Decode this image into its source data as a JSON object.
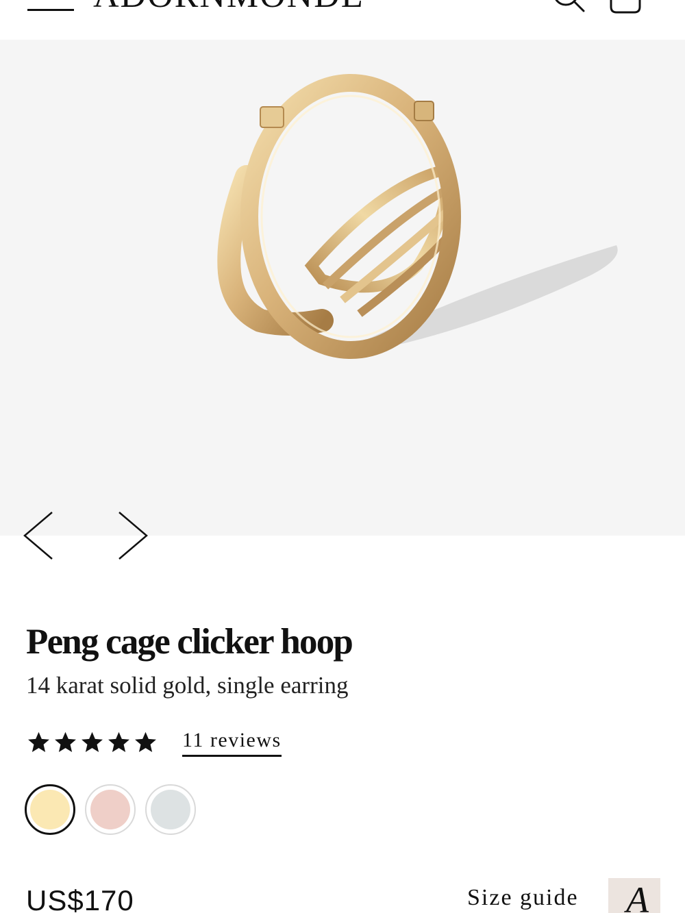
{
  "header": {
    "logo_text": "ADORNMONDE",
    "menu_icon": "hamburger-menu-icon",
    "search_icon": "search-icon",
    "bag_icon": "shopping-bag-icon"
  },
  "gallery": {
    "image_subject": "gold cage clicker hoop",
    "prev_icon": "chevron-left-icon",
    "next_icon": "chevron-right-icon",
    "background": "#f5f5f5"
  },
  "product": {
    "title": "Peng cage clicker hoop",
    "subtitle": "14 karat solid gold, single earring",
    "rating": 5,
    "reviews_label": "11 reviews",
    "swatches": [
      {
        "color": "#fbe8b3",
        "selected": true
      },
      {
        "color": "#efcfc8",
        "selected": false
      },
      {
        "color": "#dde2e3",
        "selected": false
      }
    ],
    "price": "US$170",
    "size_guide_label": "Size guide",
    "size_guide_thumb_letter": "A"
  }
}
